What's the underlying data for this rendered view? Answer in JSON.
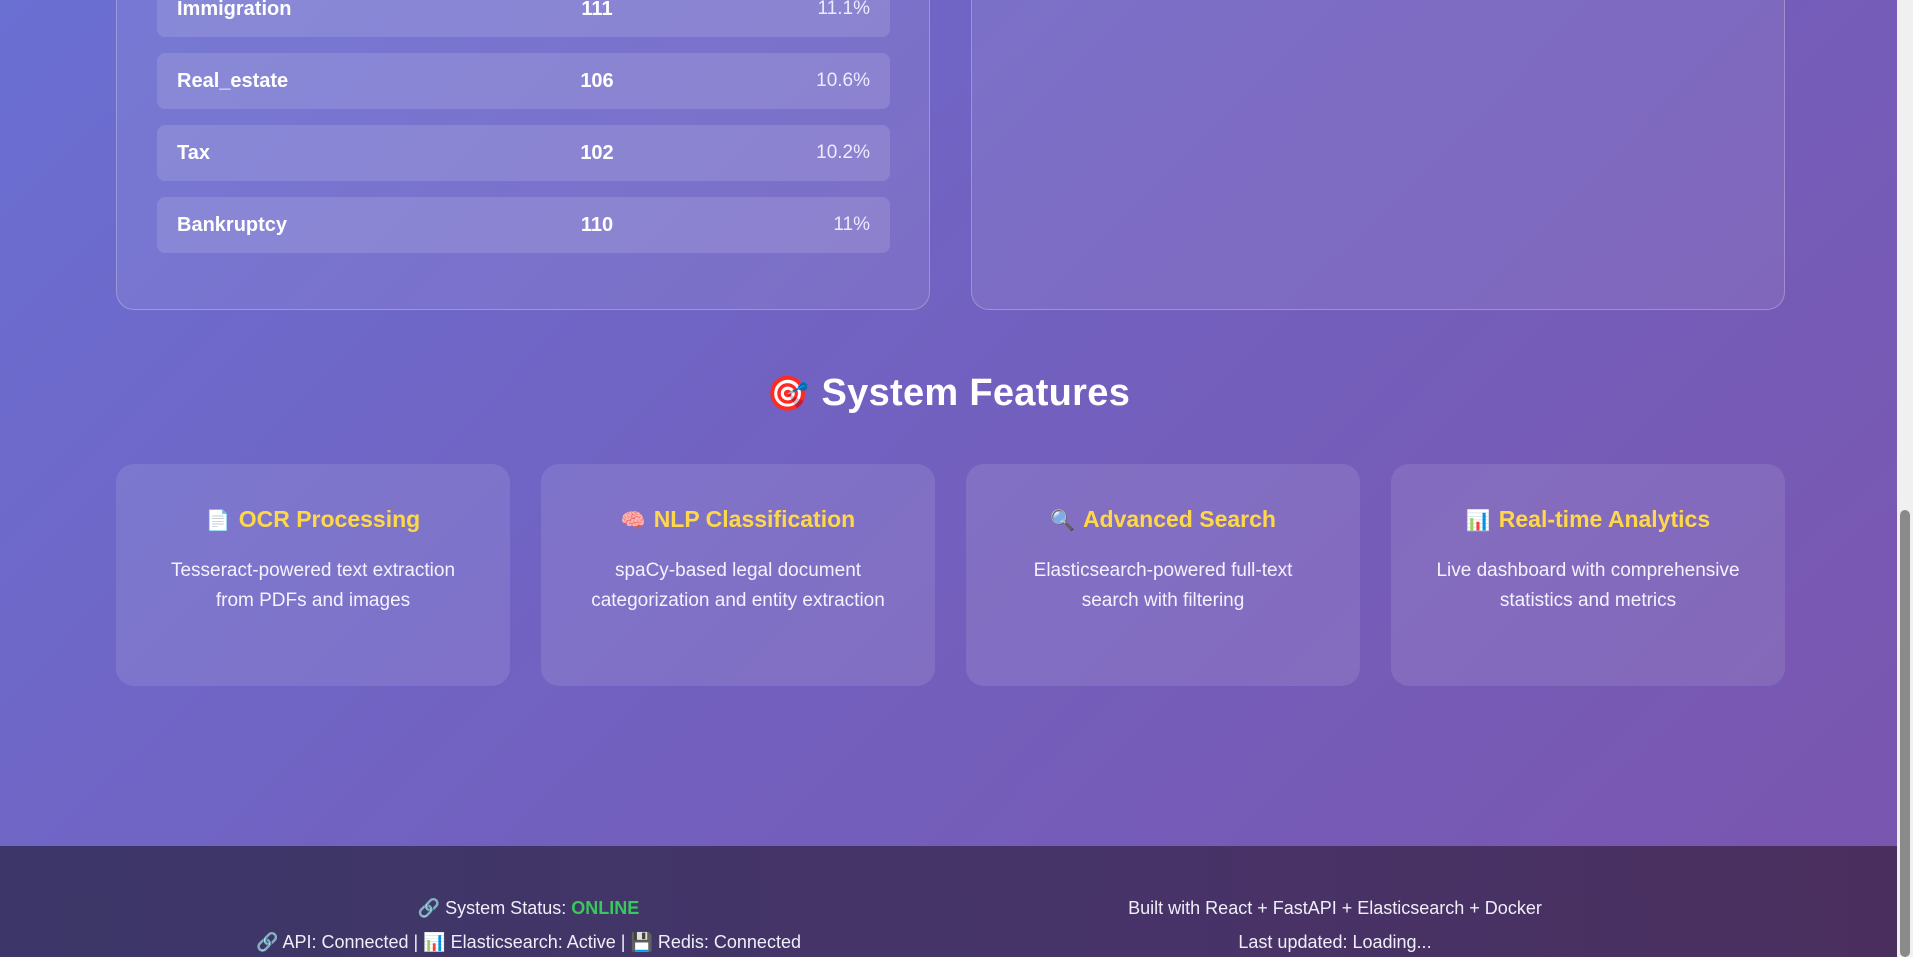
{
  "categories": [
    {
      "name": "Immigration",
      "count": "111",
      "percent": "11.1%"
    },
    {
      "name": "Real_estate",
      "count": "106",
      "percent": "10.6%"
    },
    {
      "name": "Tax",
      "count": "102",
      "percent": "10.2%"
    },
    {
      "name": "Bankruptcy",
      "count": "110",
      "percent": "11%"
    }
  ],
  "features": {
    "icon": "🎯",
    "title": "System Features",
    "items": [
      {
        "icon": "📄",
        "title": "OCR Processing",
        "description": "Tesseract-powered text extraction from PDFs and images"
      },
      {
        "icon": "🧠",
        "title": "NLP Classification",
        "description": "spaCy-based legal document categorization and entity extraction"
      },
      {
        "icon": "🔍",
        "title": "Advanced Search",
        "description": "Elasticsearch-powered full-text search with filtering"
      },
      {
        "icon": "📊",
        "title": "Real-time Analytics",
        "description": "Live dashboard with comprehensive statistics and metrics"
      }
    ]
  },
  "footer": {
    "status_icon": "🔗",
    "status_label": "System Status:",
    "status_value": "ONLINE",
    "api_icon": "🔗",
    "api_text": "API: Connected |",
    "es_icon": "📊",
    "es_text": "Elasticsearch: Active |",
    "redis_icon": "💾",
    "redis_text": "Redis: Connected",
    "built_with": "Built with React + FastAPI + Elasticsearch + Docker",
    "last_updated": "Last updated: Loading..."
  },
  "colors": {
    "accent_title": "#ffd84a",
    "status_online": "#37c95b"
  }
}
